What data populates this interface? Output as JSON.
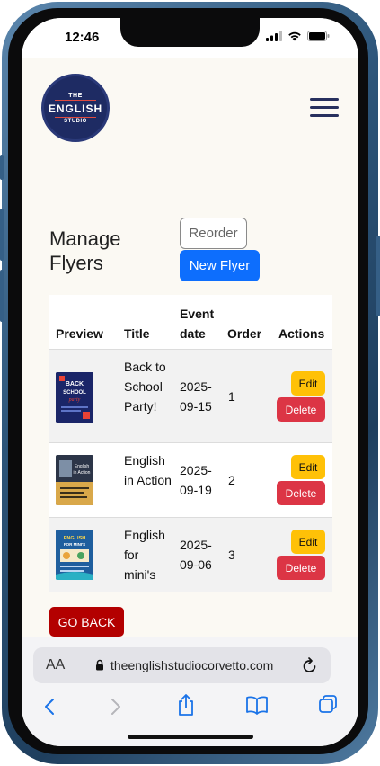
{
  "status": {
    "time": "12:46"
  },
  "header": {
    "logo_top": "THE",
    "logo_main": "ENGLISH",
    "logo_sub": "STUDIO"
  },
  "page": {
    "title": "Manage Flyers",
    "reorder_label": "Reorder",
    "new_flyer_label": "New Flyer",
    "back_label": "GO BACK"
  },
  "table": {
    "headers": {
      "preview": "Preview",
      "title": "Title",
      "event_date": "Event date",
      "order": "Order",
      "actions": "Actions"
    },
    "rows": [
      {
        "title": "Back to School Party!",
        "event_date": "2025-09-15",
        "order": "1",
        "edit": "Edit",
        "delete": "Delete",
        "thumb_text": "BACK TO SCHOOL"
      },
      {
        "title": "English in Action",
        "event_date": "2025-09-19",
        "order": "2",
        "edit": "Edit",
        "delete": "Delete",
        "thumb_text": "English in Action"
      },
      {
        "title": "English for mini's",
        "event_date": "2025-09-06",
        "order": "3",
        "edit": "Edit",
        "delete": "Delete",
        "thumb_text": "ENGLISH FOR MINI'S"
      }
    ]
  },
  "browser": {
    "aa_label": "AA",
    "url": "theenglishstudiocorvetto.com"
  },
  "colors": {
    "primary": "#0d6efd",
    "warning": "#ffc107",
    "danger": "#dc3545",
    "back": "#b30000",
    "logo": "#1e2b63"
  }
}
